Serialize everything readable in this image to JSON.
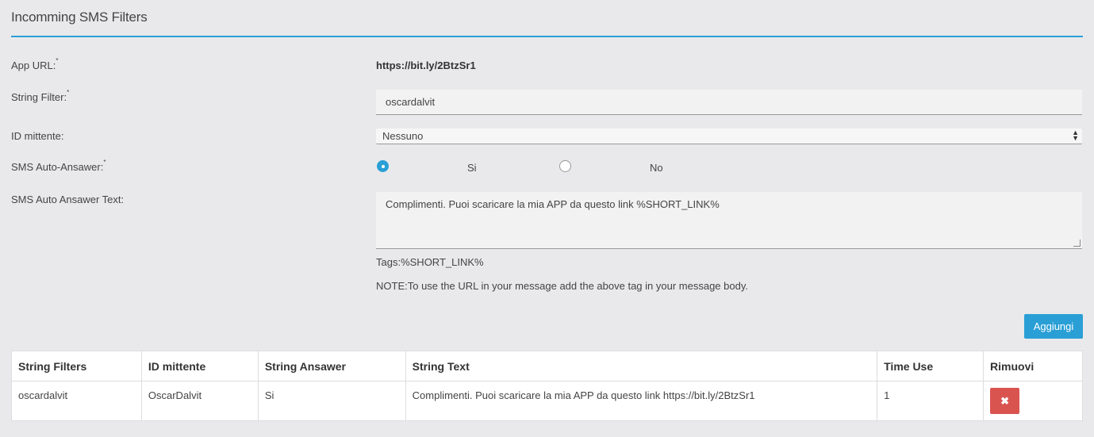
{
  "header": {
    "title": "Incomming SMS Filters"
  },
  "form": {
    "app_url_label": "App URL:",
    "app_url_value": "https://bit.ly/2BtzSr1",
    "string_filter_label": "String Filter:",
    "string_filter_value": "oscardalvit",
    "sender_id_label": "ID mittente:",
    "sender_id_selected": "Nessuno",
    "auto_answer_label": "SMS Auto-Ansawer:",
    "auto_answer_yes": "Si",
    "auto_answer_no": "No",
    "auto_answer_selected": "Si",
    "auto_answer_text_label": "SMS Auto Ansawer Text:",
    "auto_answer_text_value": "Complimenti. Puoi scaricare la mia APP da questo link %SHORT_LINK%",
    "tags_text": "Tags:%SHORT_LINK%",
    "note_text": "NOTE:To use the URL in your message add the above tag in your message body.",
    "required_mark": "*",
    "add_button": "Aggiungi"
  },
  "table": {
    "headers": [
      "String Filters",
      "ID mittente",
      "String Ansawer",
      "String Text",
      "Time Use",
      "Rimuovi"
    ],
    "rows": [
      {
        "string_filter": "oscardalvit",
        "sender_id": "OscarDalvit",
        "string_answer": "Si",
        "string_text": "Complimenti. Puoi scaricare la mia APP da questo link https://bit.ly/2BtzSr1",
        "time_use": "1",
        "remove_icon": "close-icon",
        "remove_glyph": "✖"
      }
    ]
  },
  "colors": {
    "accent": "#2a9fd6",
    "danger": "#d9534f",
    "background": "#e9e9eb"
  }
}
